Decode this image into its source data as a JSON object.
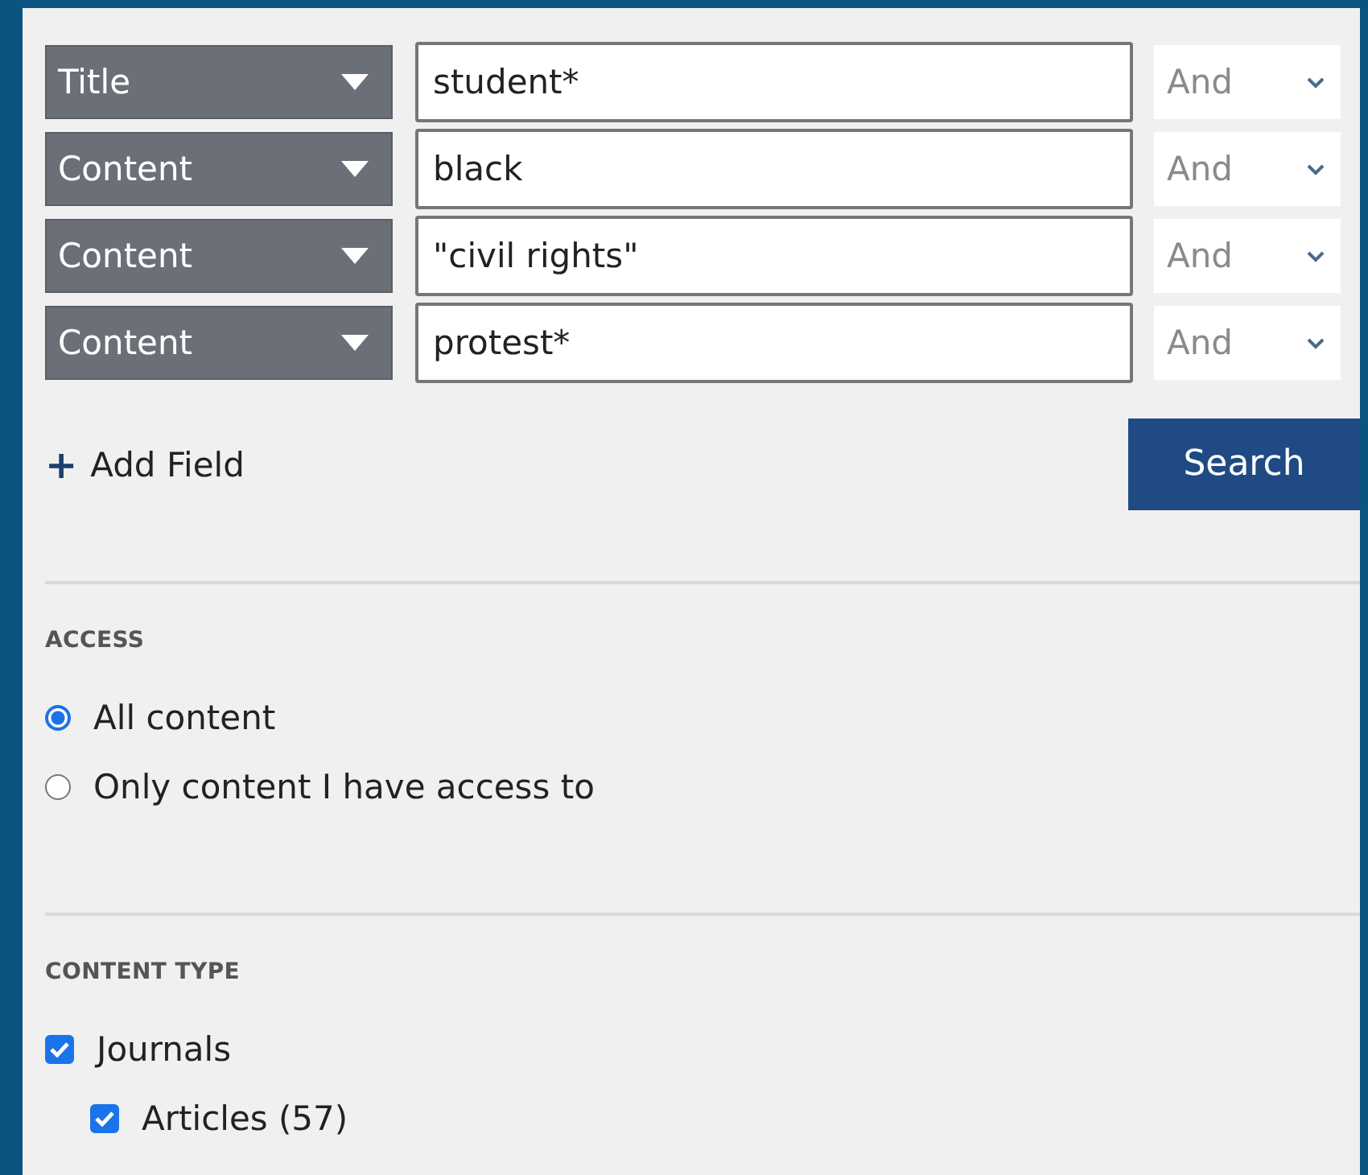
{
  "search_rows": [
    {
      "field": "Title",
      "query": "student*",
      "operator": "And"
    },
    {
      "field": "Content",
      "query": "black",
      "operator": "And"
    },
    {
      "field": "Content",
      "query": "\"civil rights\"",
      "operator": "And"
    },
    {
      "field": "Content",
      "query": "protest*",
      "operator": "And"
    }
  ],
  "add_field": {
    "icon": "+",
    "label": "Add Field"
  },
  "search_button": "Search",
  "access": {
    "heading": "ACCESS",
    "options": [
      {
        "label": "All content",
        "selected": true
      },
      {
        "label": "Only content I have access to",
        "selected": false
      }
    ]
  },
  "content_type": {
    "heading": "CONTENT TYPE",
    "items": [
      {
        "label": "Journals",
        "checked": true,
        "children": [
          {
            "label": "Articles (57)",
            "checked": true
          }
        ]
      }
    ]
  }
}
